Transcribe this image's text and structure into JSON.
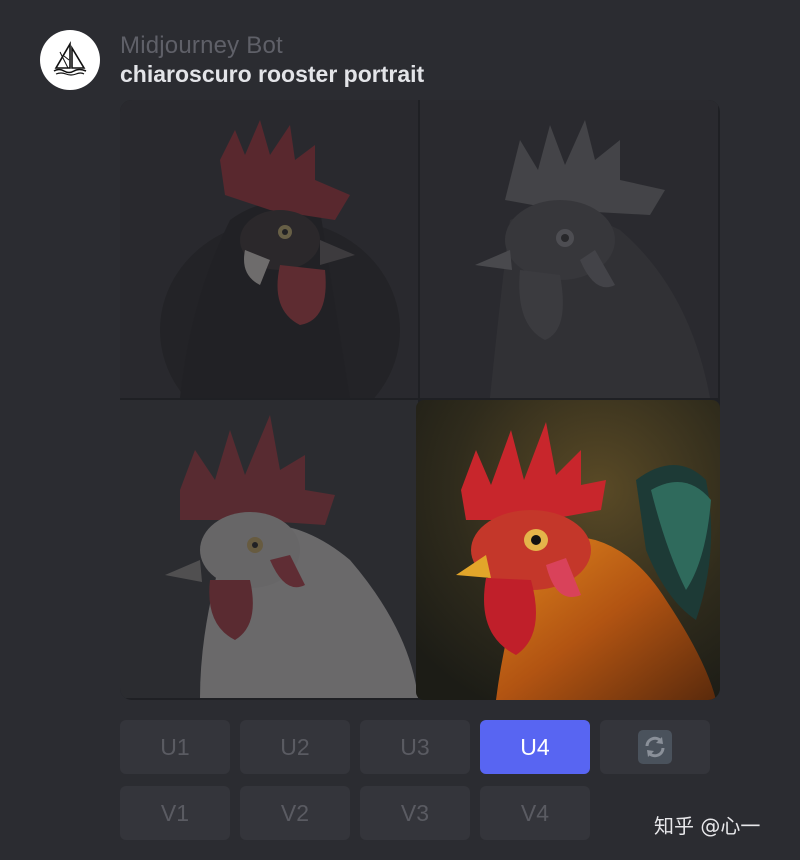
{
  "header": {
    "bot_name": "Midjourney Bot",
    "prompt": "chiaroscuro rooster portrait",
    "avatar_icon": "sailboat-logo-icon"
  },
  "grid": {
    "selected_index": 4,
    "tiles": [
      {
        "index": 1,
        "state": "dimmed"
      },
      {
        "index": 2,
        "state": "dimmed"
      },
      {
        "index": 3,
        "state": "dimmed"
      },
      {
        "index": 4,
        "state": "highlighted"
      }
    ]
  },
  "buttons": {
    "upscale": [
      "U1",
      "U2",
      "U3",
      "U4"
    ],
    "variation": [
      "V1",
      "V2",
      "V3",
      "V4"
    ],
    "reroll_icon": "refresh-icon",
    "active": "U4"
  },
  "watermark": "知乎 @心一",
  "colors": {
    "background": "#2b2c31",
    "button": "#34353b",
    "button_active": "#5865f2",
    "comb_red": "#c8262c"
  }
}
